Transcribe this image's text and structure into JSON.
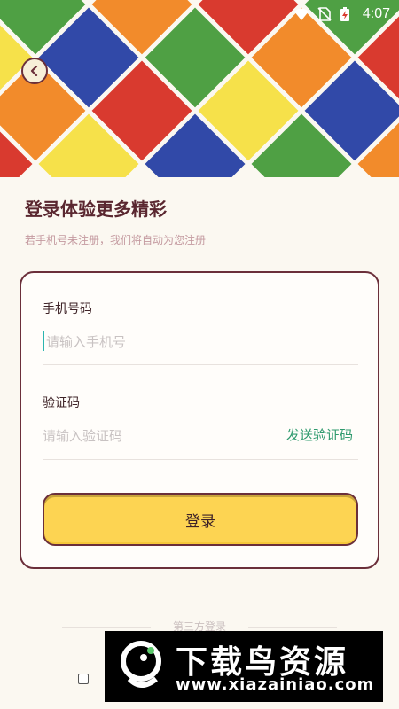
{
  "status_bar": {
    "time": "4:07",
    "icons": [
      "wifi-icon",
      "no-sim-icon",
      "battery-charging-icon"
    ]
  },
  "header": {
    "back_icon": "chevron-left-icon",
    "colors": [
      "#f6e14a",
      "#3149a8",
      "#d93a2f",
      "#4fa044",
      "#f28b2b"
    ]
  },
  "main": {
    "title": "登录体验更多精彩",
    "subtitle": "若手机号未注册，我们将自动为您注册"
  },
  "form": {
    "phone_label": "手机号码",
    "phone_placeholder": "请输入手机号",
    "code_label": "验证码",
    "code_placeholder": "请输入验证码",
    "send_code_label": "发送验证码",
    "login_label": "登录"
  },
  "footer": {
    "third_party_label": "第三方登录"
  },
  "watermark": {
    "title": "下载鸟资源",
    "url": "www.xiazainiao.com"
  }
}
